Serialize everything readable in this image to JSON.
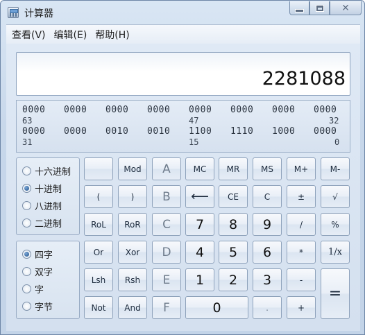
{
  "window": {
    "title": "计算器",
    "min_icon": "minimize-icon",
    "max_icon": "maximize-icon",
    "close_icon": "close-icon",
    "close_glyph": "✕"
  },
  "menu": [
    "查看(V)",
    "编辑(E)",
    "帮助(H)"
  ],
  "display": {
    "value": "2281088"
  },
  "binary": {
    "row1": [
      "0000",
      "0000",
      "0000",
      "0000",
      "0000",
      "0000",
      "0000",
      "0000"
    ],
    "row1_pos": [
      "63",
      "47",
      "32"
    ],
    "row2": [
      "0000",
      "0000",
      "0010",
      "0010",
      "1100",
      "1110",
      "1000",
      "0000"
    ],
    "row2_pos": [
      "31",
      "15",
      "0"
    ]
  },
  "radix": {
    "options": [
      "十六进制",
      "十进制",
      "八进制",
      "二进制"
    ],
    "selected": "十进制"
  },
  "word_size": {
    "options": [
      "四字",
      "双字",
      "字",
      "字节"
    ],
    "selected": "四字"
  },
  "keys": {
    "blank": "",
    "mod": "Mod",
    "a": "A",
    "mc": "MC",
    "mr": "MR",
    "ms": "MS",
    "mplus": "M+",
    "mminus": "M-",
    "lparen": "(",
    "rparen": ")",
    "b": "B",
    "back": "⟵",
    "ce": "CE",
    "c": "C",
    "pm": "±",
    "sqrt": "√",
    "rol": "RoL",
    "ror": "RoR",
    "chex": "C",
    "d7": "7",
    "d8": "8",
    "d9": "9",
    "div": "/",
    "pct": "%",
    "or": "Or",
    "xor": "Xor",
    "d": "D",
    "d4": "4",
    "d5": "5",
    "d6": "6",
    "mul": "*",
    "recip": "1/x",
    "lsh": "Lsh",
    "rsh": "Rsh",
    "e": "E",
    "d1": "1",
    "d2": "2",
    "d3": "3",
    "sub": "-",
    "eq": "=",
    "not": "Not",
    "and": "And",
    "f": "F",
    "d0": "0",
    "dot": ".",
    "add": "+"
  }
}
